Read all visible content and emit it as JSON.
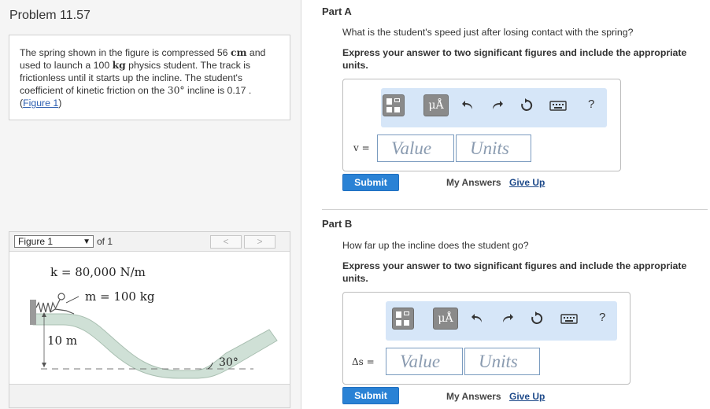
{
  "problem": {
    "title": "Problem 11.57",
    "statement": {
      "p1": "The spring shown in the figure is compressed 56 ",
      "unit_cm": "cm",
      "p2": " and used to launch a 100 ",
      "unit_kg": "kg",
      "p3": " physics student. The track is frictionless until it starts up the incline. The student's coefficient of kinetic friction on the ",
      "angle": "30°",
      "p4": " incline is 0.17 .",
      "link_open": "(",
      "link": "Figure 1",
      "link_close": ")"
    }
  },
  "figure": {
    "select_value": "Figure 1",
    "of_text": "of 1",
    "prev": "<",
    "next": ">",
    "k_label": "k = 80,000 N/m",
    "m_label": "m = 100 kg",
    "height_label": "10 m",
    "angle_label": "30°"
  },
  "partA": {
    "label": "Part A",
    "question": "What is the student's speed just after losing contact with the spring?",
    "instruction": "Express your answer to two significant figures and include the appropriate units.",
    "var": "v =",
    "value_placeholder": "Value",
    "units_placeholder": "Units",
    "submit": "Submit",
    "my_answers": "My Answers",
    "give_up": "Give Up"
  },
  "partB": {
    "label": "Part B",
    "question": "How far up the incline does the student go?",
    "instruction": "Express your answer to two significant figures and include the appropriate units.",
    "var": "Δs =",
    "value_placeholder": "Value",
    "units_placeholder": "Units",
    "submit": "Submit",
    "my_answers": "My Answers",
    "give_up": "Give Up"
  },
  "toolbar": {
    "mu_label": "μÅ",
    "help": "?",
    "icons": [
      "templates-icon",
      "units-mu-icon",
      "undo-icon",
      "redo-icon",
      "reset-icon",
      "keyboard-icon",
      "help-icon"
    ]
  },
  "colors": {
    "submit_bg": "#2a82d5",
    "toolbar_bg": "#d6e6f8",
    "track_fill": "#cfe0d6",
    "link": "#2a5db0"
  }
}
